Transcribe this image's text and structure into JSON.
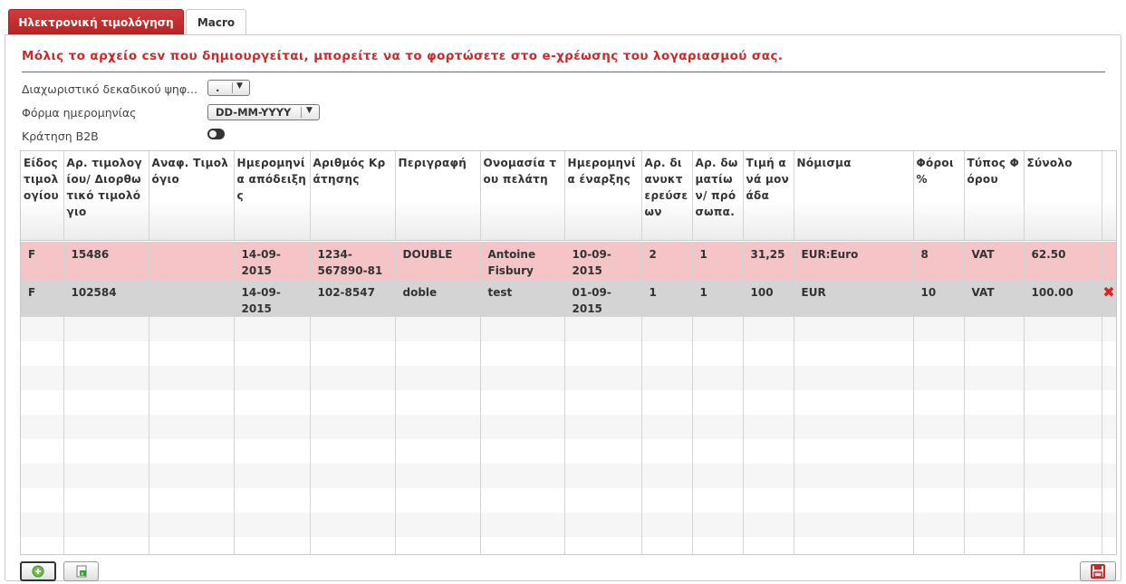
{
  "tabs": [
    {
      "label": "Ηλεκτρονική τιμολόγηση",
      "active": true
    },
    {
      "label": "Macro",
      "active": false
    }
  ],
  "notice": "Μόλις το αρχείο csv που δημιουργείται, μπορείτε να το φορτώσετε στο e-χρέωσης του λογαριασμού σας.",
  "form": {
    "decimal_label": "Διαχωριστικό δεκαδικού ψηφ...",
    "decimal_value": ".",
    "date_label": "Φόρμα ημερομηνίας",
    "date_value": "DD-MM-YYYY",
    "b2b_label": "Κράτηση B2B",
    "b2b_on": false
  },
  "table": {
    "headers": [
      "Είδος τιμολογίου",
      "Αρ. τιμολογίου/ Διορθωτικό τιμολόγιο",
      "Αναφ. Τιμολόγιο",
      "Ημερομηνία απόδειξης",
      "Αριθμός Κράτησης",
      "Περιγραφή",
      "Ονομασία του πελάτη",
      "Ημερομηνία έναρξης",
      "Αρ. διανυκτερεύσεων",
      "Αρ. δωματίων/ πρόσωπα.",
      "Τιμή ανά μονάδα",
      "Νόμισμα",
      "Φόροι %",
      "Τύπος Φόρου",
      "Σύνολο"
    ],
    "rows": [
      [
        "F",
        "15486",
        "",
        "14-09-2015",
        "1234-567890-81",
        "DOUBLE",
        "Antoine Fisbury",
        "10-09-2015",
        "2",
        "1",
        "31,25",
        "EUR:Euro",
        "8",
        "VAT",
        "62.50"
      ],
      [
        "F",
        "102584",
        "",
        "14-09-2015",
        "102-8547",
        "doble",
        "test",
        "01-09-2015",
        "1",
        "1",
        "100",
        "EUR",
        "10",
        "VAT",
        "100.00"
      ]
    ]
  },
  "icons": {
    "delete": "delete-x-icon",
    "add": "add-circle-icon",
    "export": "excel-export-icon",
    "save": "floppy-save-icon"
  },
  "colors": {
    "accent": "#cc2a2a",
    "selected_row": "#f4c4c6",
    "hover_row": "#d4d4d4"
  }
}
